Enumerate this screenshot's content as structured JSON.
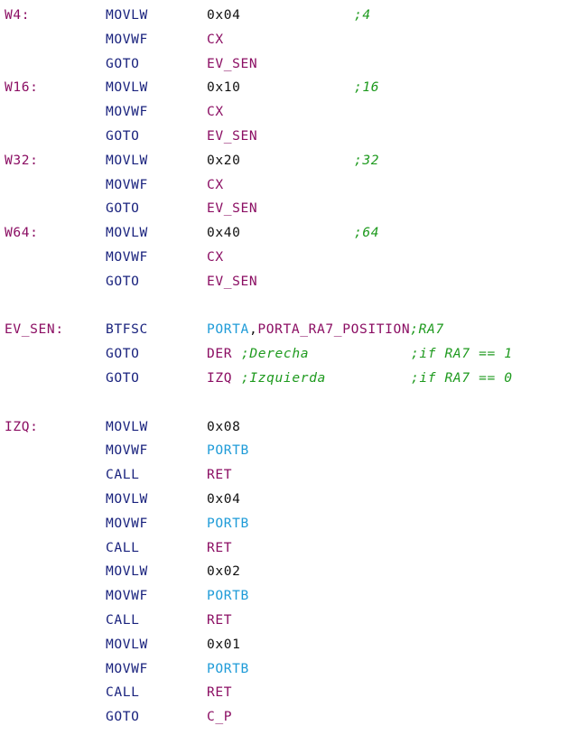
{
  "code_lines": [
    {
      "label": "W4:",
      "instr": "MOVLW",
      "op": "0x04",
      "op_color": "black",
      "comment": ";4",
      "comment_col": 4
    },
    {
      "label": "",
      "instr": "MOVWF",
      "op": "CX",
      "op_color": "purple",
      "comment": "",
      "comment_col": 0
    },
    {
      "label": "",
      "instr": "GOTO",
      "op": "EV_SEN",
      "op_color": "purple",
      "comment": "",
      "comment_col": 0
    },
    {
      "label": "W16:",
      "instr": "MOVLW",
      "op": "0x10",
      "op_color": "black",
      "comment": ";16",
      "comment_col": 4
    },
    {
      "label": "",
      "instr": "MOVWF",
      "op": "CX",
      "op_color": "purple",
      "comment": "",
      "comment_col": 0
    },
    {
      "label": "",
      "instr": "GOTO",
      "op": "EV_SEN",
      "op_color": "purple",
      "comment": "",
      "comment_col": 0
    },
    {
      "label": "W32:",
      "instr": "MOVLW",
      "op": "0x20",
      "op_color": "black",
      "comment": ";32",
      "comment_col": 4
    },
    {
      "label": "",
      "instr": "MOVWF",
      "op": "CX",
      "op_color": "purple",
      "comment": "",
      "comment_col": 0
    },
    {
      "label": "",
      "instr": "GOTO",
      "op": "EV_SEN",
      "op_color": "purple",
      "comment": "",
      "comment_col": 0
    },
    {
      "label": "W64:",
      "instr": "MOVLW",
      "op": "0x40",
      "op_color": "black",
      "comment": ";64",
      "comment_col": 4
    },
    {
      "label": "",
      "instr": "MOVWF",
      "op": "CX",
      "op_color": "purple",
      "comment": "",
      "comment_col": 0
    },
    {
      "label": "",
      "instr": "GOTO",
      "op": "EV_SEN",
      "op_color": "purple",
      "comment": "",
      "comment_col": 0
    },
    {
      "label": "",
      "instr": "",
      "op": "",
      "op_color": "black",
      "comment": "",
      "comment_col": 0
    },
    {
      "label": "EV_SEN:",
      "instr": "BTFSC",
      "op": "PORTA,PORTA_RA7_POSITION",
      "op_color": "porta",
      "comment": ";RA7",
      "comment_col": 0
    },
    {
      "label": "",
      "instr": "GOTO",
      "op": "DER",
      "op_color": "purple",
      "comment": ";Derecha",
      "comment_col": 2,
      "comment2": ";if RA7 == 1"
    },
    {
      "label": "",
      "instr": "GOTO",
      "op": "IZQ",
      "op_color": "purple",
      "comment": ";Izquierda",
      "comment_col": 2,
      "comment2": ";if RA7 == 0"
    },
    {
      "label": "",
      "instr": "",
      "op": "",
      "op_color": "black",
      "comment": "",
      "comment_col": 0
    },
    {
      "label": "IZQ:",
      "instr": "MOVLW",
      "op": "0x08",
      "op_color": "black",
      "comment": "",
      "comment_col": 0
    },
    {
      "label": "",
      "instr": "MOVWF",
      "op": "PORTB",
      "op_color": "blue",
      "comment": "",
      "comment_col": 0
    },
    {
      "label": "",
      "instr": "CALL",
      "op": "RET",
      "op_color": "purple",
      "comment": "",
      "comment_col": 0
    },
    {
      "label": "",
      "instr": "MOVLW",
      "op": "0x04",
      "op_color": "black",
      "comment": "",
      "comment_col": 0
    },
    {
      "label": "",
      "instr": "MOVWF",
      "op": "PORTB",
      "op_color": "blue",
      "comment": "",
      "comment_col": 0
    },
    {
      "label": "",
      "instr": "CALL",
      "op": "RET",
      "op_color": "purple",
      "comment": "",
      "comment_col": 0
    },
    {
      "label": "",
      "instr": "MOVLW",
      "op": "0x02",
      "op_color": "black",
      "comment": "",
      "comment_col": 0
    },
    {
      "label": "",
      "instr": "MOVWF",
      "op": "PORTB",
      "op_color": "blue",
      "comment": "",
      "comment_col": 0
    },
    {
      "label": "",
      "instr": "CALL",
      "op": "RET",
      "op_color": "purple",
      "comment": "",
      "comment_col": 0
    },
    {
      "label": "",
      "instr": "MOVLW",
      "op": "0x01",
      "op_color": "black",
      "comment": "",
      "comment_col": 0
    },
    {
      "label": "",
      "instr": "MOVWF",
      "op": "PORTB",
      "op_color": "blue",
      "comment": "",
      "comment_col": 0
    },
    {
      "label": "",
      "instr": "CALL",
      "op": "RET",
      "op_color": "purple",
      "comment": "",
      "comment_col": 0
    },
    {
      "label": "",
      "instr": "GOTO",
      "op": "C_P",
      "op_color": "purple",
      "comment": "",
      "comment_col": 0
    }
  ],
  "colors": {
    "label": "#8b0e63",
    "instruction": "#1a237e",
    "register": "#8b0e63",
    "port": "#1e9bd8",
    "literal": "#111111",
    "comment": "#1e9a1e"
  }
}
